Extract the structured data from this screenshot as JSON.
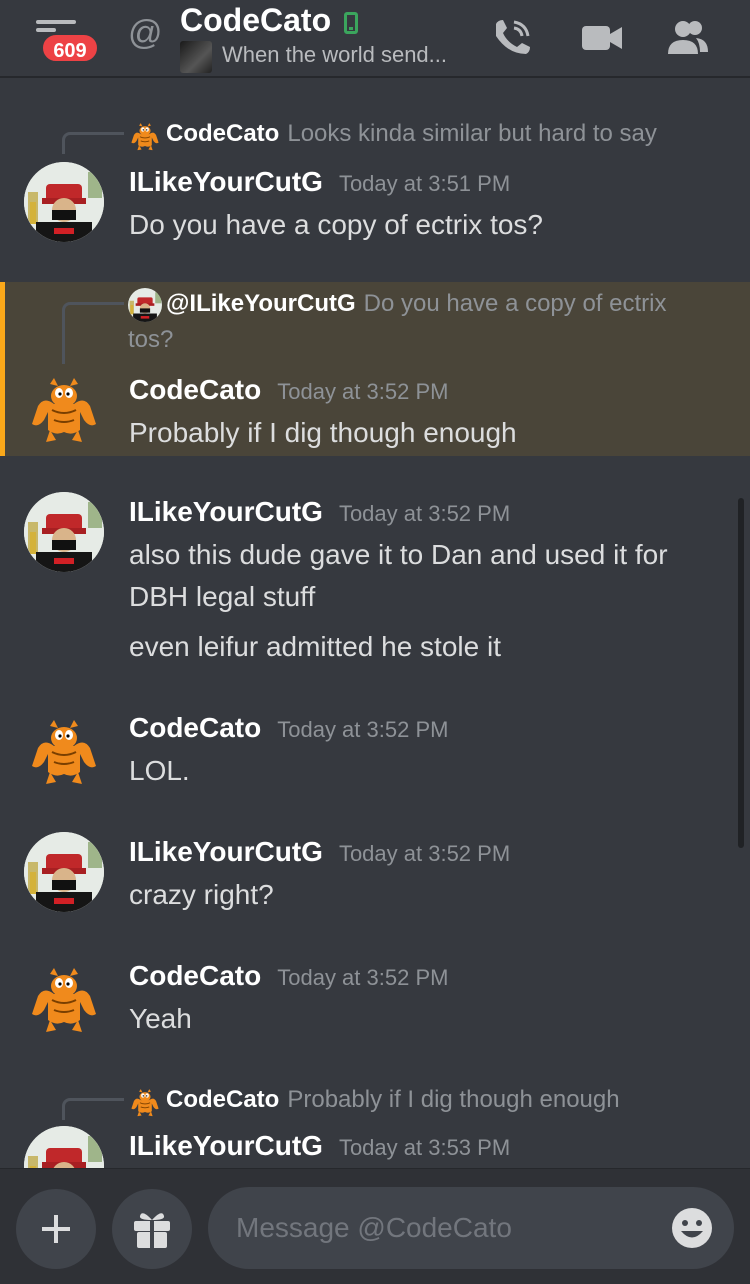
{
  "header": {
    "unread_count": "609",
    "at_symbol": "@",
    "title": "CodeCato",
    "status_text": "When the world send...",
    "icons": [
      "menu-icon",
      "mobile-status-icon",
      "call-icon",
      "video-icon",
      "members-icon"
    ]
  },
  "messages": [
    {
      "reply_to": {
        "author": "CodeCato",
        "text": "Looks kinda similar but hard to say"
      },
      "author": "ILikeYourCutG",
      "timestamp": "Today at 3:51 PM",
      "lines": [
        "Do you have a copy of ectrix tos?"
      ]
    },
    {
      "reply_to": {
        "author": "@ILikeYourCutG",
        "text": "Do you have a copy of ectrix",
        "text_cont": "tos?"
      },
      "author": "CodeCato",
      "timestamp": "Today at 3:52 PM",
      "lines": [
        "Probably if I dig though enough"
      ],
      "highlighted": true
    },
    {
      "author": "ILikeYourCutG",
      "timestamp": "Today at 3:52 PM",
      "lines": [
        "also this dude gave it to Dan and used it for",
        "DBH legal stuff",
        "even leifur admitted he stole it"
      ]
    },
    {
      "author": "CodeCato",
      "timestamp": "Today at 3:52 PM",
      "lines": [
        "LOL."
      ]
    },
    {
      "author": "ILikeYourCutG",
      "timestamp": "Today at 3:52 PM",
      "lines": [
        "crazy right?"
      ]
    },
    {
      "author": "CodeCato",
      "timestamp": "Today at 3:52 PM",
      "lines": [
        "Yeah"
      ]
    },
    {
      "reply_to": {
        "author": "CodeCato",
        "text": "Probably if I dig though enough"
      },
      "author": "ILikeYourCutG",
      "timestamp": "Today at 3:53 PM",
      "lines": []
    }
  ],
  "composer": {
    "placeholder": "Message @CodeCato",
    "icons": [
      "plus-icon",
      "gift-icon",
      "emoji-icon"
    ]
  },
  "colors": {
    "background": "#36393f",
    "highlight_bg": "#4a4539",
    "highlight_border": "#faa81a",
    "badge": "#ed4245",
    "online_mobile": "#3ba55d"
  }
}
